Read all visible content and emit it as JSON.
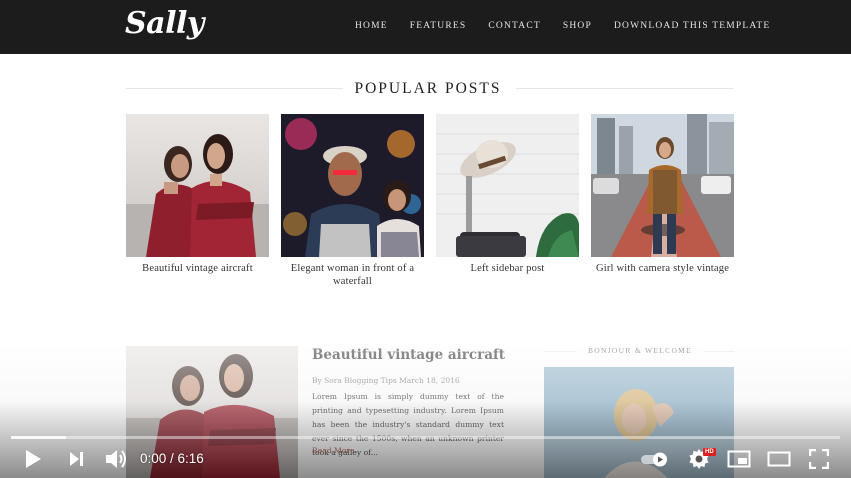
{
  "header": {
    "logo": "Sally",
    "nav": [
      "HOME",
      "FEATURES",
      "CONTACT",
      "SHOP",
      "DOWNLOAD THIS TEMPLATE"
    ]
  },
  "popular_posts": {
    "heading": "POPULAR POSTS",
    "items": [
      {
        "caption": "Beautiful vintage aircraft"
      },
      {
        "caption": "Elegant woman in front of a waterfall"
      },
      {
        "caption": "Left sidebar post"
      },
      {
        "caption": "Girl with camera style vintage"
      }
    ]
  },
  "main_post": {
    "title": "Beautiful vintage aircraft",
    "meta": "By Sora Blogging Tips March 18, 2016",
    "excerpt": "Lorem Ipsum is simply dummy text of the printing and typesetting industry. Lorem Ipsum has been the industry's standard dummy text ever since the 1500s, when an unknown printer took a galley of...",
    "read_more": "Read More"
  },
  "sidebar": {
    "heading": "BONJOUR & WELCOME"
  },
  "player": {
    "time": "0:00 / 6:16",
    "progress_fraction": 0.0,
    "buffered_fraction": 0.066,
    "hd_badge": "HD",
    "icons": [
      "play-icon",
      "next-icon",
      "volume-icon",
      "autoplay-toggle",
      "settings-icon",
      "miniplayer-icon",
      "theater-icon",
      "fullscreen-icon"
    ]
  },
  "colors": {
    "header_bg": "#1c1c1c",
    "read_more": "#b04f4f",
    "hd_badge": "#e02020"
  }
}
